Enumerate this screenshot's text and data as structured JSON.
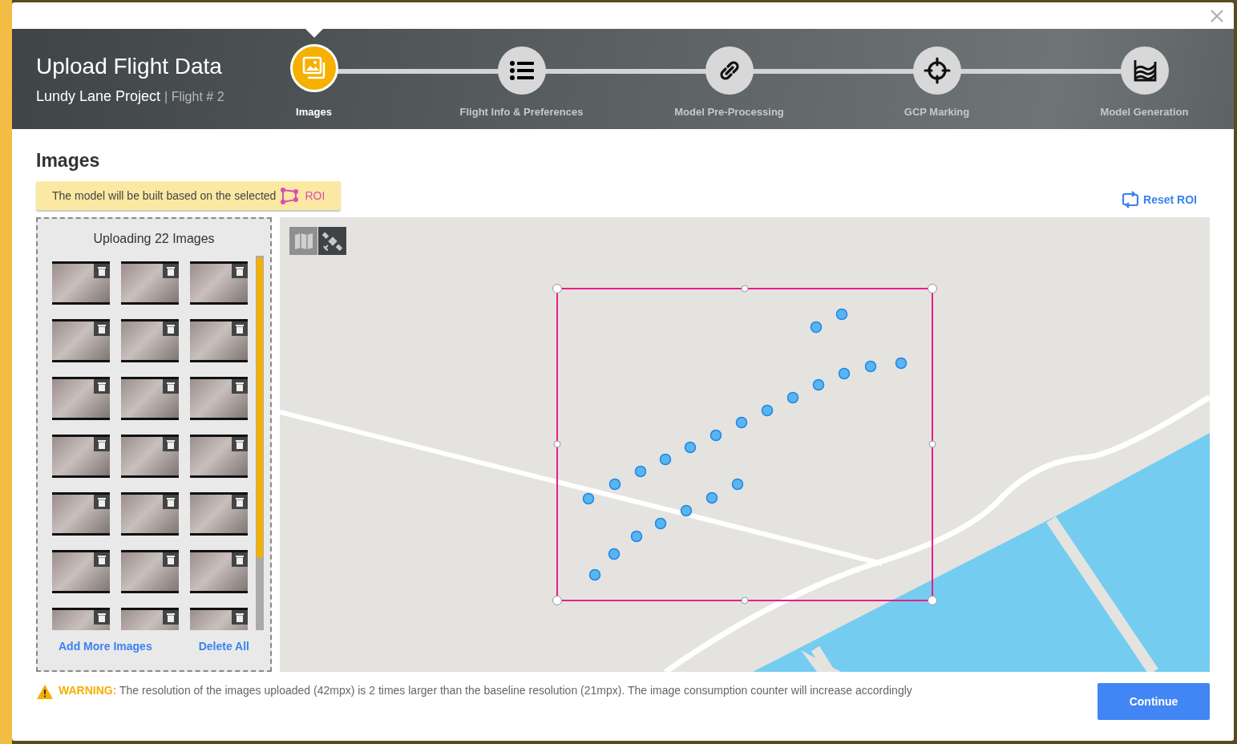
{
  "header": {
    "title": "Upload Flight Data",
    "project": "Lundy Lane Project",
    "flight": "| Flight # 2"
  },
  "steps": [
    {
      "kind": "images",
      "label": "Images",
      "selected": true
    },
    {
      "kind": "list",
      "label": "Flight Info & Preferences",
      "selected": false
    },
    {
      "kind": "link",
      "label": "Model Pre-Processing",
      "selected": false
    },
    {
      "kind": "target",
      "label": "GCP Marking",
      "selected": false
    },
    {
      "kind": "model",
      "label": "Model Generation",
      "selected": false
    }
  ],
  "section_title": "Images",
  "banner": {
    "text": "The model will be built based on the selected",
    "roi": "ROI"
  },
  "reset_roi": "Reset ROI",
  "uploader": {
    "title": "Uploading 22 Images",
    "add_more": "Add More Images",
    "delete_all": "Delete All"
  },
  "map_layers": [
    {
      "kind": "map",
      "selected": false
    },
    {
      "kind": "satellite",
      "selected": true
    }
  ],
  "warning": {
    "label": "WARNING:",
    "text": "The resolution of the images uploaded (42mpx) is 2 times larger than the baseline resolution (21mpx). The image consumption counter will increase accordingly"
  },
  "continue": "Continue"
}
